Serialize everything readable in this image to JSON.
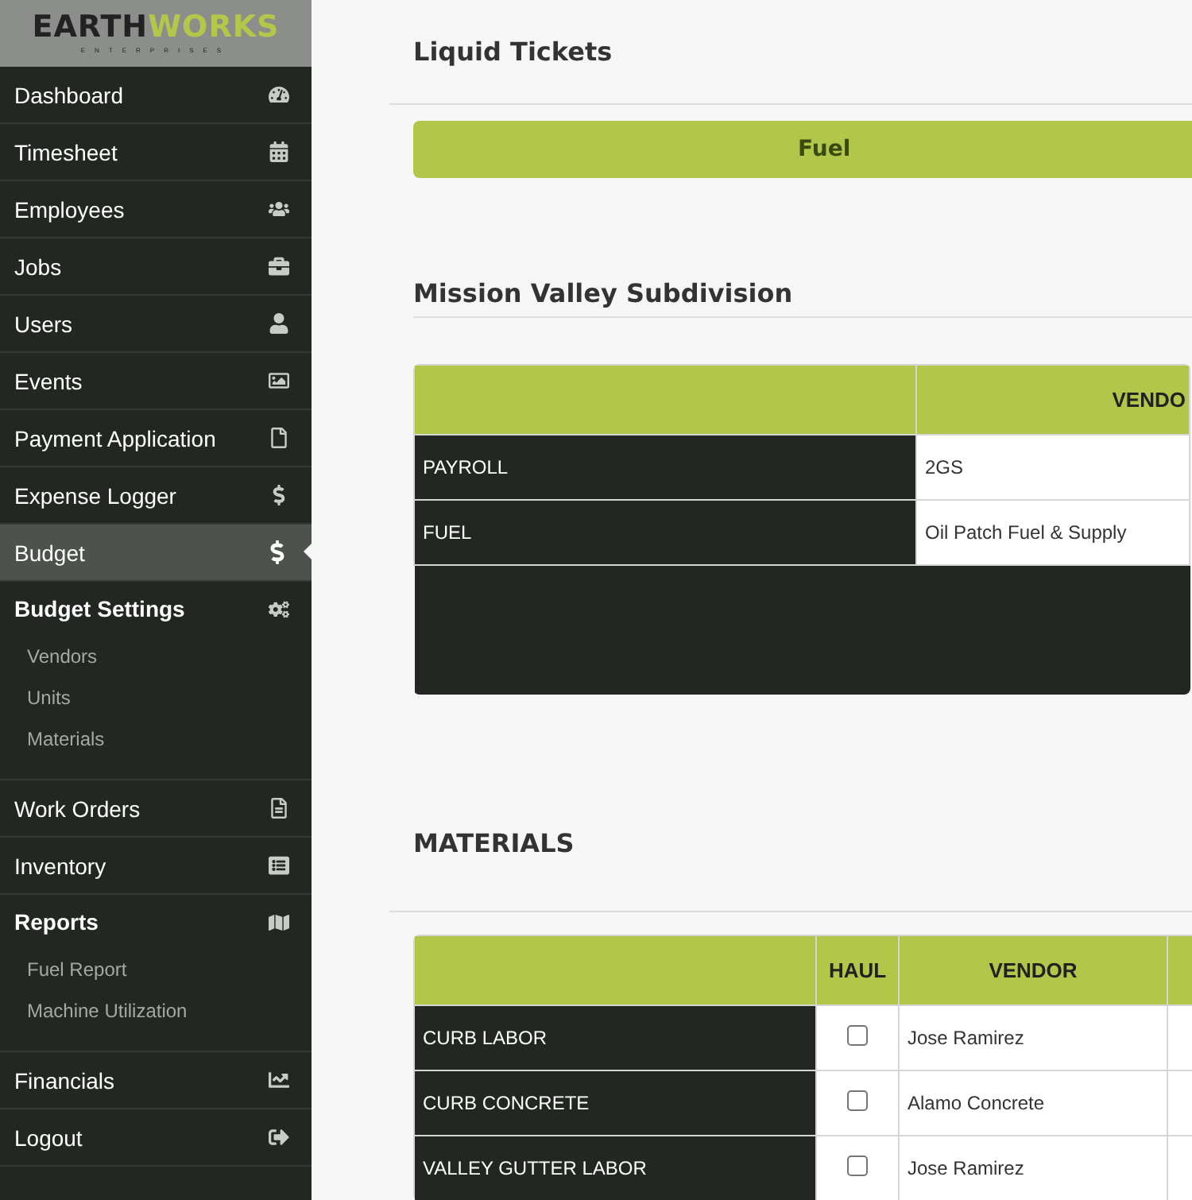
{
  "logo": {
    "dark": "EARTH",
    "accent": "WORKS",
    "tagline": "ENTERPRISES"
  },
  "sidebar": {
    "items": [
      {
        "label": "Dashboard",
        "selected": false
      },
      {
        "label": "Timesheet",
        "selected": false
      },
      {
        "label": "Employees",
        "selected": false
      },
      {
        "label": "Jobs",
        "selected": false
      },
      {
        "label": "Users",
        "selected": false
      },
      {
        "label": "Events",
        "selected": false
      },
      {
        "label": "Payment Application",
        "selected": false
      },
      {
        "label": "Expense Logger",
        "selected": false
      },
      {
        "label": "Budget",
        "selected": true
      },
      {
        "label": "Budget Settings",
        "selected": false,
        "expanded": true,
        "children": [
          {
            "label": "Vendors"
          },
          {
            "label": "Units"
          },
          {
            "label": "Materials"
          }
        ]
      },
      {
        "label": "Work Orders",
        "selected": false
      },
      {
        "label": "Inventory",
        "selected": false
      },
      {
        "label": "Reports",
        "selected": false,
        "expanded": true,
        "children": [
          {
            "label": "Fuel Report"
          },
          {
            "label": "Machine Utilization"
          }
        ]
      },
      {
        "label": "Financials",
        "selected": false
      },
      {
        "label": "Logout",
        "selected": false
      }
    ]
  },
  "liquid_tickets": {
    "title": "Liquid Tickets",
    "button": "Fuel"
  },
  "project": {
    "title": "Mission Valley Subdivision",
    "columns": [
      "",
      "VENDO"
    ],
    "rows": [
      {
        "name": "PAYROLL",
        "vendor": "2GS"
      },
      {
        "name": "FUEL",
        "vendor": "Oil Patch Fuel & Supply"
      }
    ]
  },
  "materials": {
    "title": "MATERIALS",
    "columns": [
      "",
      "HAUL",
      "VENDOR",
      ""
    ],
    "rows": [
      {
        "name": "CURB LABOR",
        "haul": false,
        "vendor": "Jose Ramirez"
      },
      {
        "name": "CURB CONCRETE",
        "haul": false,
        "vendor": "Alamo Concrete"
      },
      {
        "name": "VALLEY GUTTER LABOR",
        "haul": false,
        "vendor": "Jose Ramirez"
      }
    ]
  }
}
